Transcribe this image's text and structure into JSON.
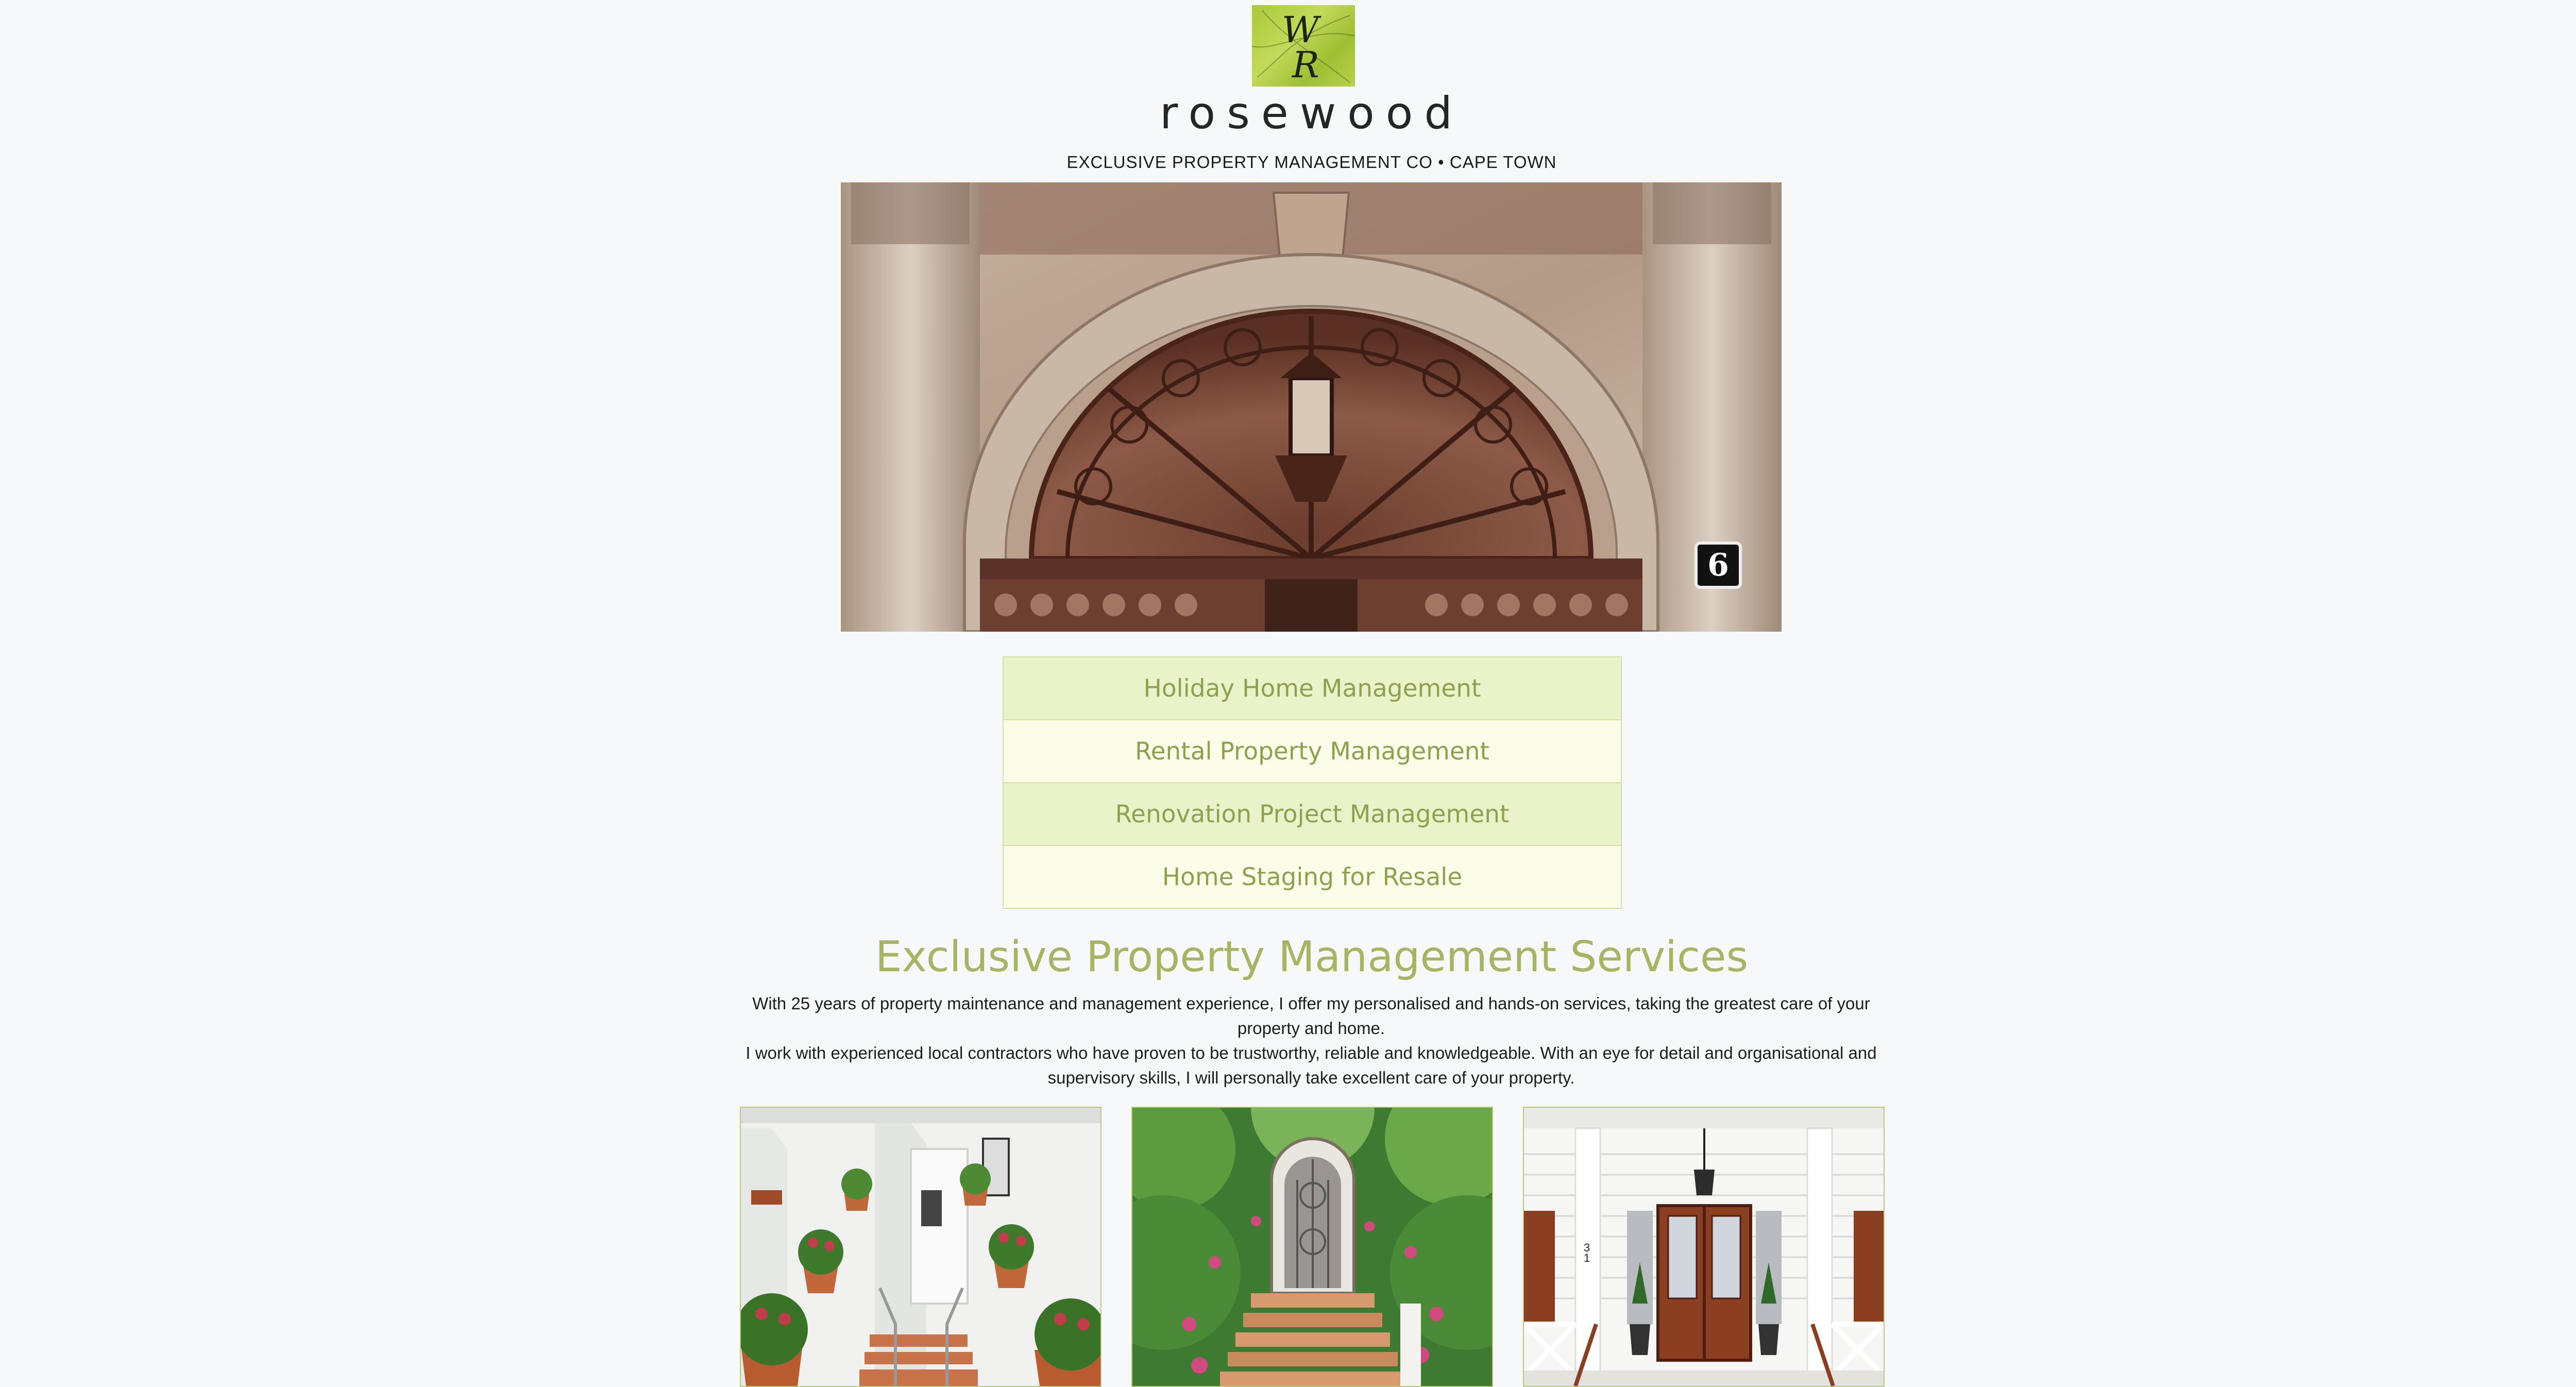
{
  "header": {
    "logo_name": "wr-monogram-logo",
    "logo_text": "WR",
    "brand": "rosewood",
    "tagline": "EXCLUSIVE PROPERTY MANAGEMENT CO • CAPE TOWN"
  },
  "hero": {
    "number_plate": "6"
  },
  "services": [
    {
      "label": "Holiday Home Management"
    },
    {
      "label": "Rental Property Management"
    },
    {
      "label": "Renovation Project Management"
    },
    {
      "label": "Home Staging for Resale"
    }
  ],
  "main": {
    "heading": "Exclusive Property Management Services",
    "paragraph_1": "With 25 years of property maintenance and management experience, I offer my personalised and hands-on services, taking the greatest care of your property and home.",
    "paragraph_2": "I work with experienced local contractors who have proven to be trustworthy, reliable and knowledgeable. With an eye for detail and organisational and supervisory skills, I will personally take excellent care of your property."
  },
  "cards": {
    "house_number": "31"
  },
  "colors": {
    "accent": "#a7b463",
    "menu_text": "#8da14f",
    "menu_odd": "#eaf2c9",
    "menu_even": "#fbfde8",
    "border": "#d6e0a3",
    "page_bg": "#f7f8f9"
  }
}
